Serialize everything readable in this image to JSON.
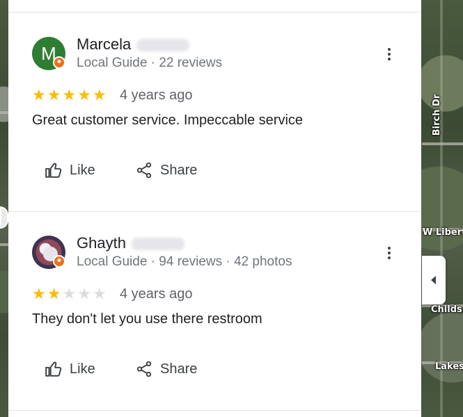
{
  "map": {
    "labels": [
      "Birch Dr",
      "W Libert",
      "Childs",
      "Lakes"
    ]
  },
  "reviews": [
    {
      "avatar_letter": "M",
      "name": "Marcela",
      "meta": "Local Guide · 22 reviews",
      "rating": 5,
      "stars": [
        "★",
        "★",
        "★",
        "★",
        "★"
      ],
      "time": "4 years ago",
      "text": "Great customer service. Impeccable service",
      "like_label": "Like",
      "share_label": "Share",
      "avatar_color": "#2e7d32"
    },
    {
      "avatar_letter": "",
      "name": "Ghayth",
      "meta": "Local Guide · 94 reviews · 42 photos",
      "rating": 2,
      "stars": [
        "★",
        "★",
        "★",
        "★",
        "★"
      ],
      "time": "4 years ago",
      "text": "They don't let you use there restroom",
      "like_label": "Like",
      "share_label": "Share"
    }
  ],
  "colors": {
    "star_on": "#fbbc04",
    "star_off": "#dadce0",
    "guide_badge": "#e8711a"
  }
}
